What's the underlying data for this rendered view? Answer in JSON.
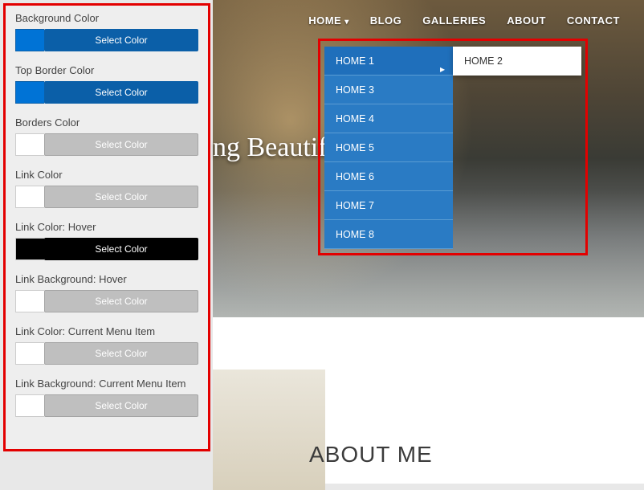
{
  "customizer": {
    "groups": [
      {
        "label": "Background Color",
        "swatch": "blue",
        "btn": "blue",
        "btnLabel": "Select Color"
      },
      {
        "label": "Top Border Color",
        "swatch": "blue",
        "btn": "blue",
        "btnLabel": "Select Color"
      },
      {
        "label": "Borders Color",
        "swatch": "white",
        "btn": "gray",
        "btnLabel": "Select Color"
      },
      {
        "label": "Link Color",
        "swatch": "white",
        "btn": "gray",
        "btnLabel": "Select Color"
      },
      {
        "label": "Link Color: Hover",
        "swatch": "black",
        "btn": "black",
        "btnLabel": "Select Color"
      },
      {
        "label": "Link Background: Hover",
        "swatch": "white",
        "btn": "gray",
        "btnLabel": "Select Color"
      },
      {
        "label": "Link Color: Current Menu Item",
        "swatch": "white",
        "btn": "gray",
        "btnLabel": "Select Color"
      },
      {
        "label": "Link Background: Current Menu Item",
        "swatch": "white",
        "btn": "gray",
        "btnLabel": "Select Color"
      }
    ]
  },
  "nav": {
    "items": [
      "HOME",
      "BLOG",
      "GALLERIES",
      "ABOUT",
      "CONTACT"
    ]
  },
  "hero": {
    "textFragment": "ng Beautif                  ts."
  },
  "dropdown": {
    "items": [
      "HOME 1",
      "HOME 3",
      "HOME 4",
      "HOME 5",
      "HOME 6",
      "HOME 7",
      "HOME 8"
    ],
    "sub": "HOME 2"
  },
  "section": {
    "title": "ABOUT ME"
  },
  "colors": {
    "highlight": "#e30000",
    "menuBg": "#2a7bc4",
    "menuBorder": "#5a9cd3"
  }
}
